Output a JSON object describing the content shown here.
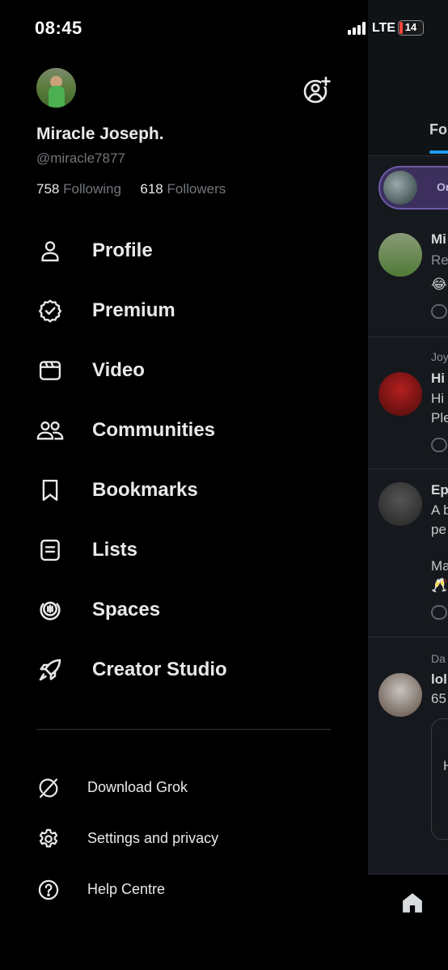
{
  "status_bar": {
    "time": "08:45",
    "network": "LTE",
    "battery": "14",
    "battery_level": 0.14,
    "battery_color": "#ff453a"
  },
  "profile": {
    "display_name": "Miracle Joseph.",
    "handle": "@miracle7877",
    "following_count": "758",
    "following_label": "Following",
    "followers_count": "618",
    "followers_label": "Followers",
    "add_account_icon": "person-add-icon"
  },
  "menu": {
    "items": [
      {
        "label": "Profile",
        "icon": "person-icon"
      },
      {
        "label": "Premium",
        "icon": "verified-badge-icon"
      },
      {
        "label": "Video",
        "icon": "video-icon"
      },
      {
        "label": "Communities",
        "icon": "communities-icon"
      },
      {
        "label": "Bookmarks",
        "icon": "bookmark-icon"
      },
      {
        "label": "Lists",
        "icon": "list-icon"
      },
      {
        "label": "Spaces",
        "icon": "spaces-icon"
      },
      {
        "label": "Creator Studio",
        "icon": "rocket-icon"
      }
    ],
    "secondary": [
      {
        "label": "Download Grok",
        "icon": "grok-icon"
      },
      {
        "label": "Settings and privacy",
        "icon": "gear-icon"
      },
      {
        "label": "Help Centre",
        "icon": "help-icon"
      }
    ]
  },
  "timeline": {
    "tab_fragment": "Fo",
    "pill_fragment": "Or",
    "rows": [
      {
        "line1": "Mi",
        "line2": "Re",
        "line3": "😂"
      },
      {
        "context": "Joy",
        "line1": "Hi",
        "line2": "Hi",
        "line3": "Ple"
      },
      {
        "line1": "Ep",
        "line2": "A b",
        "line3": "pe",
        "line4": "Ma",
        "line5": "🥂"
      },
      {
        "context": "Da",
        "line1": "lol",
        "line2": "65",
        "line3": "H"
      }
    ],
    "home_icon": "home-icon"
  },
  "colors": {
    "background": "#000000",
    "text_primary": "#e7e9ea",
    "text_secondary": "#71767b",
    "accent": "#1d9bf0"
  }
}
